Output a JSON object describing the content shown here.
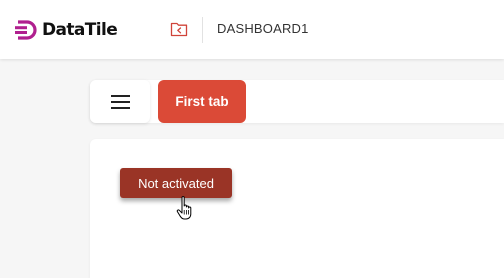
{
  "app": {
    "logo_text": "DataTile",
    "brand_color": "#b0208f"
  },
  "header": {
    "folder_icon": "folder-back-icon",
    "breadcrumb": "DASHBOARD1"
  },
  "tabs": {
    "menu_icon": "hamburger-menu-icon",
    "active_tab_label": "First tab",
    "active_tab_color": "#db4a37"
  },
  "panel": {
    "button_label": "Not activated",
    "button_color": "#9a3426",
    "cursor_icon": "hand-pointer-icon"
  }
}
